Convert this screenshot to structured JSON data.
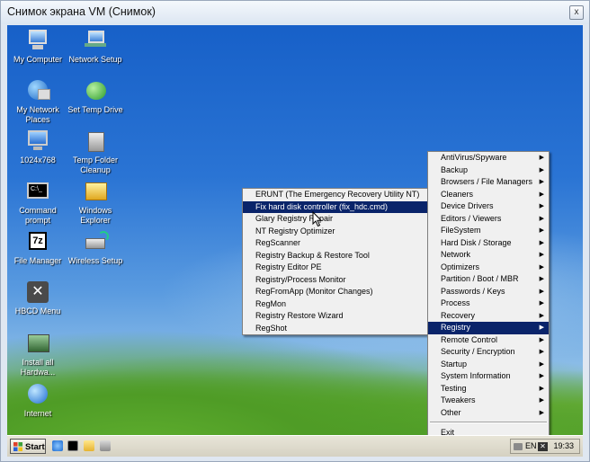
{
  "host_window": {
    "title": "Снимок экрана VM (Снимок)",
    "close_glyph": "x"
  },
  "desktop_icons": [
    {
      "label": "My Computer",
      "icon": "computer-icon"
    },
    {
      "label": "Network Setup",
      "icon": "network-setup-icon"
    },
    {
      "label": "My Network Places",
      "icon": "network-places-icon"
    },
    {
      "label": "Set Temp Drive",
      "icon": "temp-drive-icon"
    },
    {
      "label": "1024x768",
      "icon": "monitor-icon"
    },
    {
      "label": "Temp Folder Cleanup",
      "icon": "cleanup-icon"
    },
    {
      "label": "Command prompt",
      "icon": "command-prompt-icon"
    },
    {
      "label": "Windows Explorer",
      "icon": "explorer-icon"
    },
    {
      "label": "File Manager",
      "icon": "file-manager-icon"
    },
    {
      "label": "Wireless Setup",
      "icon": "wireless-icon"
    },
    {
      "label": "HBCD Menu",
      "icon": "tools-icon"
    },
    {
      "label": "Install all Hardwa...",
      "icon": "install-hardware-icon"
    },
    {
      "label": "Internet",
      "icon": "internet-icon"
    }
  ],
  "main_menu": {
    "items": [
      {
        "label": "AntiVirus/Spyware"
      },
      {
        "label": "Backup"
      },
      {
        "label": "Browsers / File Managers"
      },
      {
        "label": "Cleaners"
      },
      {
        "label": "Device Drivers"
      },
      {
        "label": "Editors / Viewers"
      },
      {
        "label": "FileSystem"
      },
      {
        "label": "Hard Disk / Storage"
      },
      {
        "label": "Network"
      },
      {
        "label": "Optimizers"
      },
      {
        "label": "Partition / Boot / MBR"
      },
      {
        "label": "Passwords / Keys"
      },
      {
        "label": "Process"
      },
      {
        "label": "Recovery"
      },
      {
        "label": "Registry"
      },
      {
        "label": "Remote Control"
      },
      {
        "label": "Security / Encryption"
      },
      {
        "label": "Startup"
      },
      {
        "label": "System Information"
      },
      {
        "label": "Testing"
      },
      {
        "label": "Tweakers"
      },
      {
        "label": "Other"
      }
    ],
    "highlighted": "Registry",
    "exit_label": "Exit",
    "arrow_glyph": "▶"
  },
  "registry_submenu": {
    "items": [
      {
        "label": "ERUNT (The Emergency Recovery Utility NT)"
      },
      {
        "label": "Fix hard disk controller (fix_hdc.cmd)"
      },
      {
        "label": "Glary Registry Repair"
      },
      {
        "label": "NT Registry Optimizer"
      },
      {
        "label": "RegScanner"
      },
      {
        "label": "Registry Backup & Restore Tool"
      },
      {
        "label": "Registry Editor PE"
      },
      {
        "label": "Registry/Process Monitor"
      },
      {
        "label": "RegFromApp (Monitor Changes)"
      },
      {
        "label": "RegMon"
      },
      {
        "label": "Registry Restore Wizard"
      },
      {
        "label": "RegShot"
      }
    ],
    "highlighted": "Fix hard disk controller (fix_hdc.cmd)"
  },
  "taskbar": {
    "start_label": "Start",
    "quick_launch": [
      "ie-icon",
      "console-icon",
      "folder-icon",
      "desktop-icon"
    ],
    "tray": {
      "language": "EN",
      "time": "19:33"
    }
  },
  "colors": {
    "menu_highlight": "#0a246a",
    "menu_bg": "#f0f0f0"
  }
}
